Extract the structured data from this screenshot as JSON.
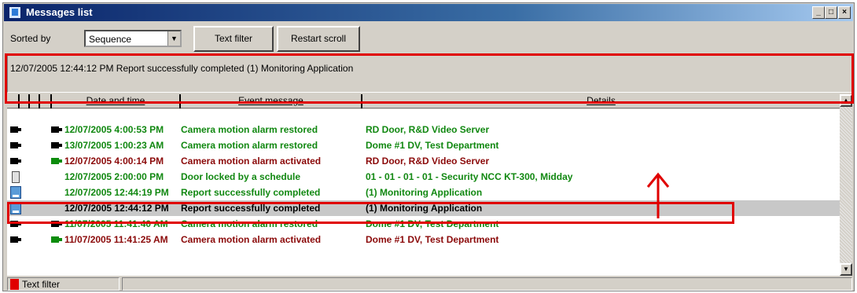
{
  "window": {
    "title": "Messages list",
    "controls": [
      "_",
      "□",
      "×"
    ]
  },
  "toolbar": {
    "sorted_by_label": "Sorted by",
    "sort_value": "Sequence",
    "text_filter_button": "Text filter",
    "restart_scroll_button": "Restart scroll"
  },
  "info_bar": {
    "text": "12/07/2005 12:44:12 PM  Report successfully completed  (1) Monitoring Application"
  },
  "table": {
    "headers": [
      "Date and time",
      "Event message",
      "Details"
    ],
    "rows": [
      {
        "icon": "camera-icon",
        "dt": "12/07/2005 4:00:53 PM",
        "ev": "Camera motion alarm restored",
        "de": "RD Door, R&D Video Server",
        "color": "#118811"
      },
      {
        "icon": "camera-icon",
        "dt": "13/07/2005 1:00:23 AM",
        "ev": "Camera motion alarm restored",
        "de": "Dome #1 DV, Test Department",
        "color": "#118811"
      },
      {
        "icon": "camera-icon",
        "dt": "12/07/2005 4:00:14 PM",
        "ev": "Camera motion alarm activated",
        "de": "RD Door, R&D Video Server",
        "color": "#8b0a0a"
      },
      {
        "icon": "door-icon",
        "dt": "12/07/2005 2:00:00 PM",
        "ev": "Door locked by a schedule",
        "de": "01 - 01 - 01 - 01 - Security NCC KT-300, Midday",
        "color": "#118811"
      },
      {
        "icon": "report-icon",
        "dt": "12/07/2005 12:44:19 PM",
        "ev": "Report successfully completed",
        "de": "(1)  Monitoring Application",
        "color": "#118811"
      },
      {
        "icon": "report-icon",
        "dt": "12/07/2005 12:44:12 PM",
        "ev": "Report successfully completed",
        "de": "(1)  Monitoring Application",
        "color": "#000000",
        "selected": true
      },
      {
        "icon": "camera-icon",
        "dt": "11/07/2005 11:41:40 AM",
        "ev": "Camera motion alarm restored",
        "de": "Dome #1 DV, Test Department",
        "color": "#118811"
      },
      {
        "icon": "camera-icon",
        "dt": "11/07/2005 11:41:25 AM",
        "ev": "Camera motion alarm activated",
        "de": "Dome #1 DV, Test Department",
        "color": "#8b0a0a"
      }
    ]
  },
  "status_bar": {
    "text_filter_label": "Text filter",
    "indicator_color": "#e00000"
  },
  "annotation_color": "#e00000"
}
